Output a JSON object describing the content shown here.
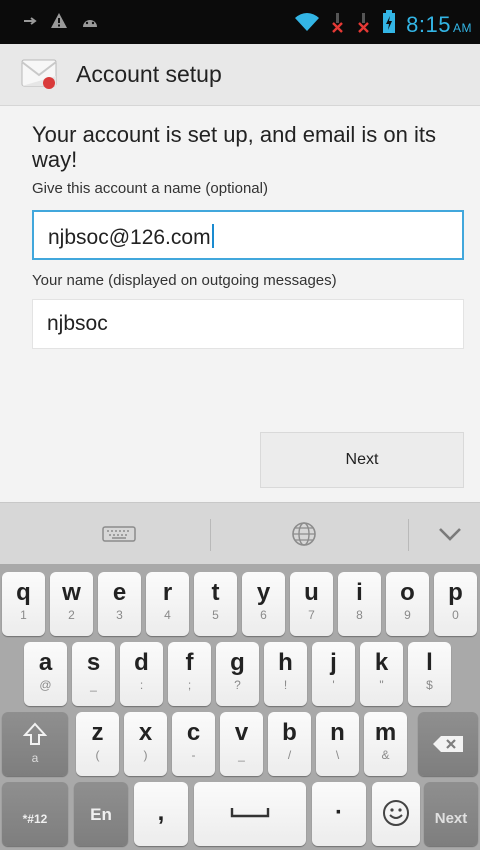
{
  "status_bar": {
    "time": "8:15",
    "ampm": "AM",
    "icons": [
      "usb-icon",
      "warning-icon",
      "android-debug-icon",
      "wifi-icon",
      "no-signal-icon",
      "no-signal-icon",
      "battery-icon"
    ]
  },
  "action_bar": {
    "title": "Account setup",
    "icon": "email-app-icon"
  },
  "form": {
    "headline": "Your account is set up, and email is on its way!",
    "account_name_label": "Give this account a name (optional)",
    "account_name_value": "njbsoc@126.com",
    "your_name_label": "Your name (displayed on outgoing messages)",
    "your_name_value": "njbsoc",
    "next_label": "Next"
  },
  "keyboard": {
    "toolbar_icons": [
      "keyboard-icon",
      "globe-icon",
      "chevron-down-icon"
    ],
    "row1": [
      {
        "k": "q",
        "s": "1"
      },
      {
        "k": "w",
        "s": "2"
      },
      {
        "k": "e",
        "s": "3"
      },
      {
        "k": "r",
        "s": "4"
      },
      {
        "k": "t",
        "s": "5"
      },
      {
        "k": "y",
        "s": "6"
      },
      {
        "k": "u",
        "s": "7"
      },
      {
        "k": "i",
        "s": "8"
      },
      {
        "k": "o",
        "s": "9"
      },
      {
        "k": "p",
        "s": "0"
      }
    ],
    "row2": [
      {
        "k": "a",
        "s": "@"
      },
      {
        "k": "s",
        "s": "_"
      },
      {
        "k": "d",
        "s": ":"
      },
      {
        "k": "f",
        "s": ";"
      },
      {
        "k": "g",
        "s": "?"
      },
      {
        "k": "h",
        "s": "!"
      },
      {
        "k": "j",
        "s": "'"
      },
      {
        "k": "k",
        "s": "\""
      },
      {
        "k": "l",
        "s": "$"
      }
    ],
    "row3": [
      {
        "k": "z",
        "s": "("
      },
      {
        "k": "x",
        "s": ")"
      },
      {
        "k": "c",
        "s": "-"
      },
      {
        "k": "v",
        "s": "_"
      },
      {
        "k": "b",
        "s": "/"
      },
      {
        "k": "n",
        "s": "\\"
      },
      {
        "k": "m",
        "s": "&"
      }
    ],
    "shift_sub": "a",
    "symbols_label": "*#12",
    "lang_label": "En",
    "comma_label": ",",
    "period_label": "·",
    "enter_label": "Next"
  }
}
